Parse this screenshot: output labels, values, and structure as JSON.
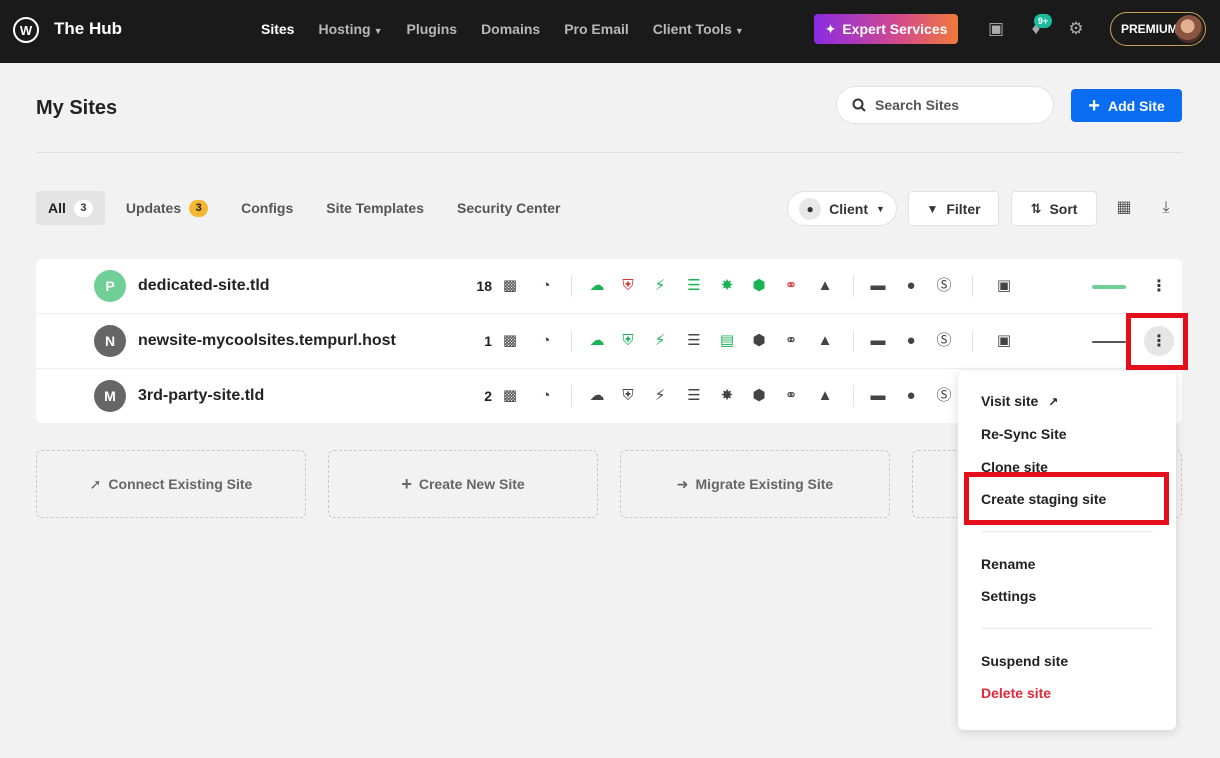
{
  "app": {
    "logo_glyph": "W",
    "brand": "The Hub"
  },
  "nav": {
    "items": [
      {
        "label": "Sites",
        "active": true,
        "caret": false
      },
      {
        "label": "Hosting",
        "active": false,
        "caret": true
      },
      {
        "label": "Plugins",
        "active": false,
        "caret": false
      },
      {
        "label": "Domains",
        "active": false,
        "caret": false
      },
      {
        "label": "Pro Email",
        "active": false,
        "caret": false
      },
      {
        "label": "Client Tools",
        "active": false,
        "caret": true
      }
    ],
    "expert_services": "Expert Services",
    "notifications_count": "9+",
    "plan": "PREMIUM"
  },
  "page": {
    "title": "My Sites",
    "search_placeholder": "Search Sites",
    "add_site": "Add Site"
  },
  "tabs": [
    {
      "label": "All",
      "count": "3",
      "active": true
    },
    {
      "label": "Updates",
      "count": "3",
      "active": false
    },
    {
      "label": "Configs",
      "count": "",
      "active": false
    },
    {
      "label": "Site Templates",
      "count": "",
      "active": false
    },
    {
      "label": "Security Center",
      "count": "",
      "active": false
    }
  ],
  "toolbar": {
    "client": "Client",
    "filter": "Filter",
    "sort": "Sort"
  },
  "sites": [
    {
      "initial": "P",
      "avatar_color": "#6fcf97",
      "name": "dedicated-site.tld",
      "updates": "18",
      "health_color": "#6fcf97"
    },
    {
      "initial": "N",
      "avatar_color": "#666666",
      "name": "newsite-mycoolsites.tempurl.host",
      "updates": "1",
      "health_color": "#555555"
    },
    {
      "initial": "M",
      "avatar_color": "#666666",
      "name": "3rd-party-site.tld",
      "updates": "2",
      "health_color": ""
    }
  ],
  "actions": {
    "connect": "Connect Existing Site",
    "create": "Create New Site",
    "migrate": "Migrate Existing Site"
  },
  "menu": {
    "visit_site": "Visit site",
    "resync": "Re-Sync Site",
    "clone": "Clone site",
    "create_staging": "Create staging site",
    "rename": "Rename",
    "settings": "Settings",
    "suspend": "Suspend site",
    "delete": "Delete site"
  },
  "colors": {
    "accent_blue": "#0a6cf1",
    "success_green": "#1ab354",
    "danger_red": "#e0283a",
    "highlight_red": "#e3101b"
  }
}
